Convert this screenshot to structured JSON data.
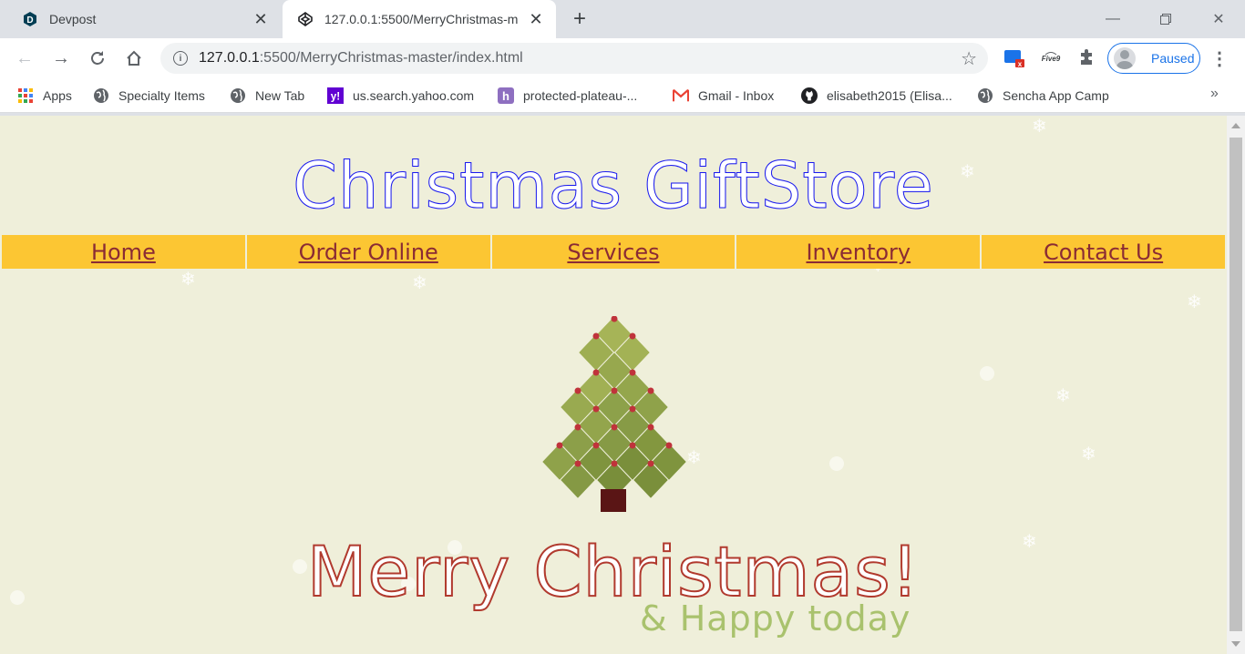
{
  "browser": {
    "tabs": [
      {
        "title": "Devpost",
        "icon": "devpost-icon",
        "active": false
      },
      {
        "title": "127.0.0.1:5500/MerryChristmas-m",
        "icon": "codepen-icon",
        "active": true
      }
    ],
    "address": {
      "host": "127.0.0.1",
      "rest": ":5500/MerryChristmas-master/index.html"
    },
    "profile_label": "Paused",
    "bookmarks": [
      {
        "label": "Apps",
        "icon": "apps-grid-icon"
      },
      {
        "label": "Specialty Items",
        "icon": "globe-icon"
      },
      {
        "label": "New Tab",
        "icon": "globe-icon"
      },
      {
        "label": "us.search.yahoo.com",
        "icon": "yahoo-icon"
      },
      {
        "label": "protected-plateau-...",
        "icon": "heroku-icon"
      },
      {
        "label": "Gmail - Inbox",
        "icon": "gmail-icon"
      },
      {
        "label": "elisabeth2015 (Elisa...",
        "icon": "github-icon"
      },
      {
        "label": "Sencha App Camp",
        "icon": "globe-icon"
      }
    ]
  },
  "page": {
    "title": "Christmas GiftStore",
    "nav": [
      "Home",
      "Order Online",
      "Services",
      "Inventory",
      "Contact Us"
    ],
    "greeting": "Merry Christmas!",
    "subgreeting": "& Happy today",
    "colors": {
      "background": "#efefda",
      "title": "#1a1aee",
      "nav_bg": "#fcc633",
      "nav_text": "#8a2b34",
      "greeting": "#b13a2e",
      "subgreeting": "#a9c26d",
      "tree_green": "#8da14a",
      "ornament": "#c0333b",
      "trunk": "#5a1515"
    }
  }
}
